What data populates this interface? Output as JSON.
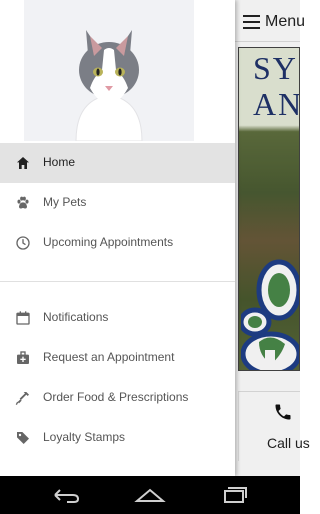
{
  "app": {
    "menu_label": "Menu",
    "banner_line1": "SYC",
    "banner_line2": "AN",
    "call_label": "Call us"
  },
  "drawer": {
    "items": [
      {
        "label": "Home",
        "icon": "home-icon",
        "active": true
      },
      {
        "label": "My Pets",
        "icon": "paw-icon",
        "active": false
      },
      {
        "label": "Upcoming Appointments",
        "icon": "clock-icon",
        "active": false
      },
      {
        "label": "Notifications",
        "icon": "calendar-icon",
        "active": false
      },
      {
        "label": "Request an Appointment",
        "icon": "medical-bag-icon",
        "active": false
      },
      {
        "label": "Order Food & Prescriptions",
        "icon": "syringe-icon",
        "active": false
      },
      {
        "label": "Loyalty Stamps",
        "icon": "tag-icon",
        "active": false
      }
    ]
  },
  "system_nav": {
    "buttons": [
      "back-icon",
      "home-button-icon",
      "recents-icon"
    ]
  },
  "colors": {
    "drawer_active_bg": "#e3e3e3",
    "banner_text": "#20346c",
    "paw_blue": "#1f3f8a",
    "paw_green": "#4a8a4a",
    "navbar_bg": "#000000"
  }
}
